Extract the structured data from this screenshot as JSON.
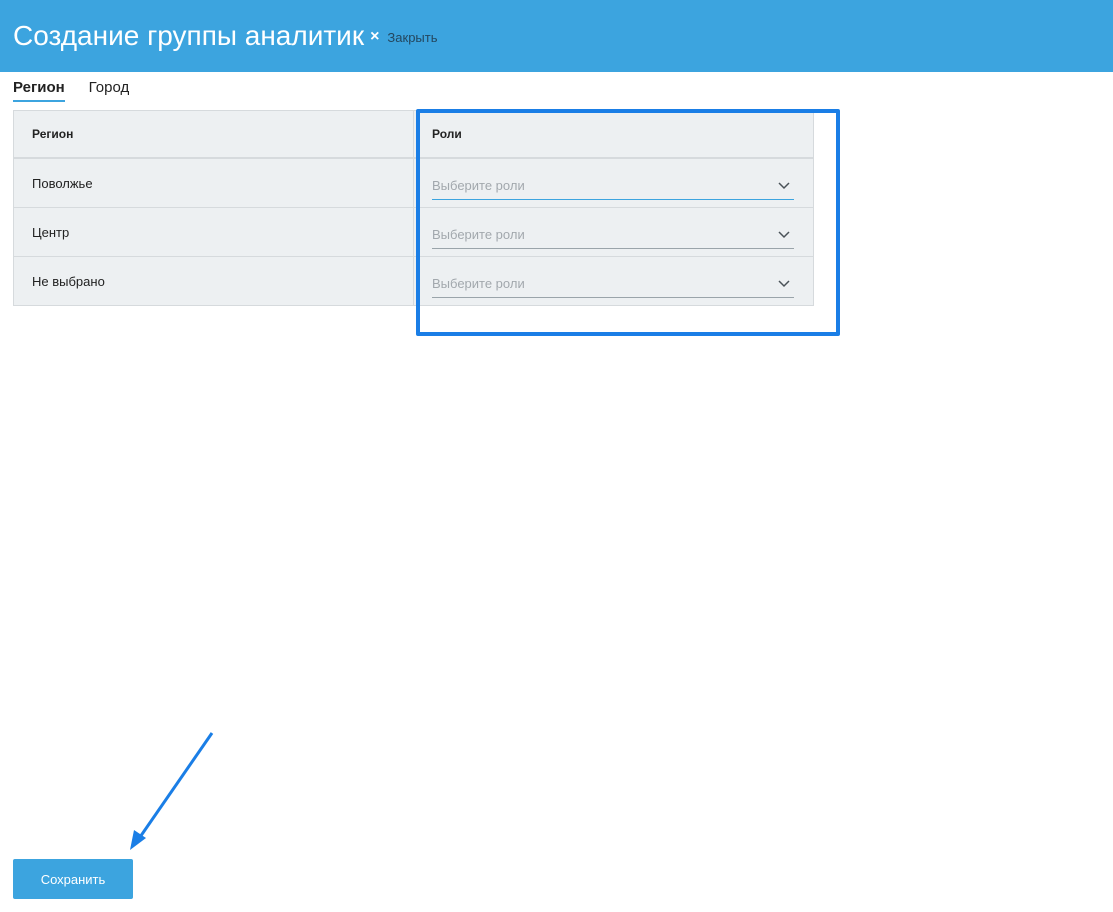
{
  "header": {
    "title": "Создание группы аналитик",
    "close_icon": "×",
    "close_label": "Закрыть"
  },
  "tabs": [
    {
      "label": "Регион",
      "active": true
    },
    {
      "label": "Город",
      "active": false
    }
  ],
  "table": {
    "columns": [
      "Регион",
      "Роли"
    ],
    "rows": [
      {
        "region": "Поволжье",
        "roles_placeholder": "Выберите роли"
      },
      {
        "region": "Центр",
        "roles_placeholder": "Выберите роли"
      },
      {
        "region": "Не выбрано",
        "roles_placeholder": "Выберите роли"
      }
    ]
  },
  "footer": {
    "save_label": "Сохранить"
  },
  "colors": {
    "header_bg": "#3ca4df",
    "annotation": "#1a7ee6",
    "table_bg": "#edf0f2"
  }
}
